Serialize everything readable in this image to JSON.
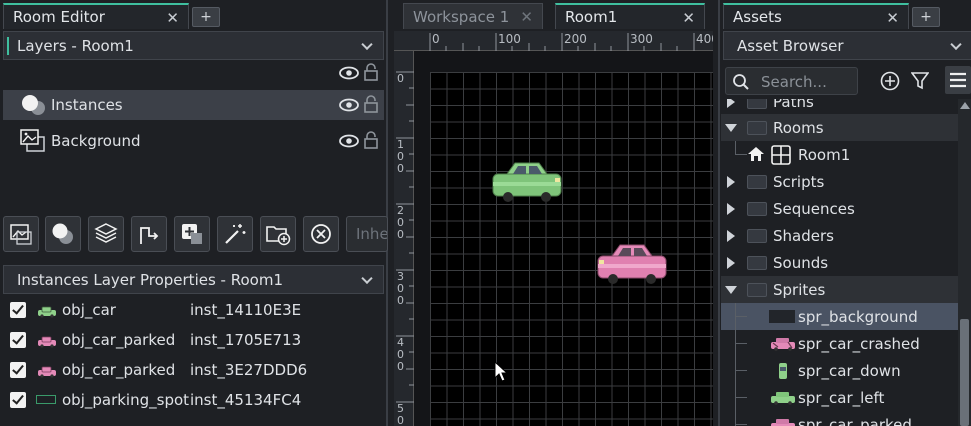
{
  "room_editor": {
    "tab_title": "Room Editor",
    "layers_header": "Layers - Room1",
    "layers": [
      {
        "name": "Instances",
        "selected": true
      },
      {
        "name": "Background",
        "selected": false
      }
    ],
    "toolbar_input_placeholder": "Inhe",
    "props_header": "Instances Layer Properties - Room1",
    "instances": [
      {
        "object": "obj_car",
        "id": "inst_14110E3E",
        "icon_color": "#8fd08a"
      },
      {
        "object": "obj_car_parked",
        "id": "inst_1705E713",
        "icon_color": "#e48ab8"
      },
      {
        "object": "obj_car_parked",
        "id": "inst_3E27DDD6",
        "icon_color": "#e48ab8"
      },
      {
        "object": "obj_parking_spot",
        "id": "inst_45134FC4",
        "icon_color": "#3a9a6a"
      }
    ]
  },
  "workspace": {
    "tabs": [
      {
        "label": "Workspace 1",
        "active": false
      },
      {
        "label": "Room1",
        "active": true
      }
    ],
    "ruler_top": [
      "0",
      "100",
      "200",
      "300",
      "400"
    ],
    "ruler_left": [
      "0",
      "1\n0\n0",
      "2\n0\n0",
      "3\n0\n0",
      "4\n0\n0",
      "5\n0"
    ]
  },
  "assets": {
    "tab_title": "Assets",
    "browser_title": "Asset Browser",
    "search_placeholder": "Search...",
    "items": [
      {
        "label": "Paths",
        "type": "folder",
        "state": "collapsed",
        "level": 0
      },
      {
        "label": "Rooms",
        "type": "folder",
        "state": "expanded",
        "level": 0
      },
      {
        "label": "Room1",
        "type": "room",
        "level": 1
      },
      {
        "label": "Scripts",
        "type": "folder",
        "state": "collapsed",
        "level": 0
      },
      {
        "label": "Sequences",
        "type": "folder",
        "state": "collapsed",
        "level": 0
      },
      {
        "label": "Shaders",
        "type": "folder",
        "state": "collapsed",
        "level": 0
      },
      {
        "label": "Sounds",
        "type": "folder",
        "state": "collapsed",
        "level": 0
      },
      {
        "label": "Sprites",
        "type": "folder",
        "state": "expanded",
        "level": 0
      },
      {
        "label": "spr_background",
        "type": "sprite",
        "level": 1,
        "selected": true
      },
      {
        "label": "spr_car_crashed",
        "type": "sprite",
        "level": 1
      },
      {
        "label": "spr_car_down",
        "type": "sprite",
        "level": 1
      },
      {
        "label": "spr_car_left",
        "type": "sprite",
        "level": 1
      },
      {
        "label": "spr_car_parked",
        "type": "sprite",
        "level": 1
      }
    ]
  },
  "colors": {
    "accent": "#3fbf9f",
    "selected_row": "#3c4048",
    "green_car": "#8fd08a",
    "pink_car": "#e48ab8"
  }
}
